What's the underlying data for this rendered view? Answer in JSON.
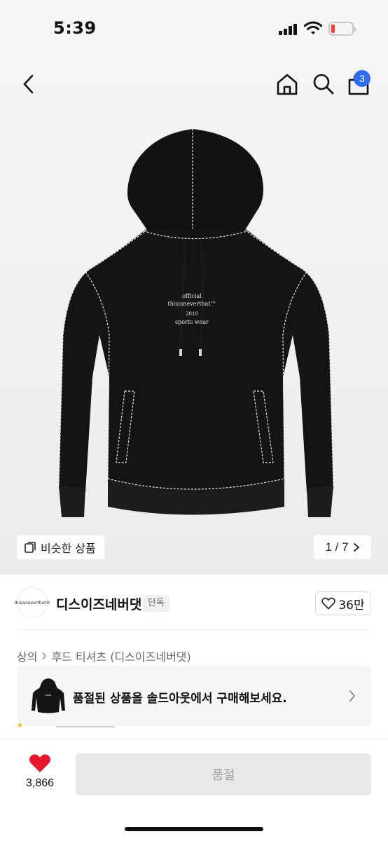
{
  "status_bar": {
    "time": "5:39"
  },
  "nav": {
    "cart_count": "3"
  },
  "gallery": {
    "similar_label": "비슷한 상품",
    "counter": "1 / 7",
    "hoodie_print": [
      "official",
      "thisisneverthat™",
      "2010",
      "sports wear"
    ]
  },
  "brand": {
    "logo_text": "thisisneverthat®",
    "name": "디스이즈네버댓",
    "exclusive_label": "단독",
    "like_count": "36만"
  },
  "breadcrumb": {
    "category": "상의",
    "subcategory": "후드 티셔츠 (디스이즈네버댓)"
  },
  "soldout_banner": {
    "text": "품절된 상품을 솔드아웃에서 구매해보세요."
  },
  "bottom_bar": {
    "wish_count": "3,866",
    "buy_label": "품절"
  },
  "colors": {
    "accent": "#2d6ef4",
    "heart": "#e8142a"
  }
}
